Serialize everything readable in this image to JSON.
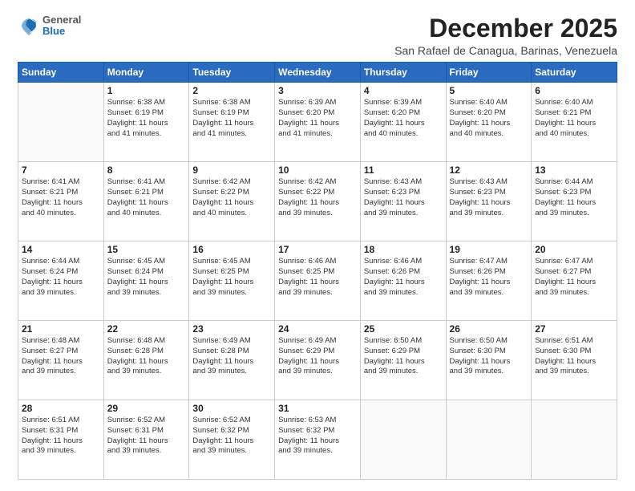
{
  "logo": {
    "general": "General",
    "blue": "Blue"
  },
  "title": "December 2025",
  "location": "San Rafael de Canagua, Barinas, Venezuela",
  "weekdays": [
    "Sunday",
    "Monday",
    "Tuesday",
    "Wednesday",
    "Thursday",
    "Friday",
    "Saturday"
  ],
  "weeks": [
    [
      {
        "day": "",
        "info": ""
      },
      {
        "day": "1",
        "info": "Sunrise: 6:38 AM\nSunset: 6:19 PM\nDaylight: 11 hours\nand 41 minutes."
      },
      {
        "day": "2",
        "info": "Sunrise: 6:38 AM\nSunset: 6:19 PM\nDaylight: 11 hours\nand 41 minutes."
      },
      {
        "day": "3",
        "info": "Sunrise: 6:39 AM\nSunset: 6:20 PM\nDaylight: 11 hours\nand 41 minutes."
      },
      {
        "day": "4",
        "info": "Sunrise: 6:39 AM\nSunset: 6:20 PM\nDaylight: 11 hours\nand 40 minutes."
      },
      {
        "day": "5",
        "info": "Sunrise: 6:40 AM\nSunset: 6:20 PM\nDaylight: 11 hours\nand 40 minutes."
      },
      {
        "day": "6",
        "info": "Sunrise: 6:40 AM\nSunset: 6:21 PM\nDaylight: 11 hours\nand 40 minutes."
      }
    ],
    [
      {
        "day": "7",
        "info": "Sunrise: 6:41 AM\nSunset: 6:21 PM\nDaylight: 11 hours\nand 40 minutes."
      },
      {
        "day": "8",
        "info": "Sunrise: 6:41 AM\nSunset: 6:21 PM\nDaylight: 11 hours\nand 40 minutes."
      },
      {
        "day": "9",
        "info": "Sunrise: 6:42 AM\nSunset: 6:22 PM\nDaylight: 11 hours\nand 40 minutes."
      },
      {
        "day": "10",
        "info": "Sunrise: 6:42 AM\nSunset: 6:22 PM\nDaylight: 11 hours\nand 39 minutes."
      },
      {
        "day": "11",
        "info": "Sunrise: 6:43 AM\nSunset: 6:23 PM\nDaylight: 11 hours\nand 39 minutes."
      },
      {
        "day": "12",
        "info": "Sunrise: 6:43 AM\nSunset: 6:23 PM\nDaylight: 11 hours\nand 39 minutes."
      },
      {
        "day": "13",
        "info": "Sunrise: 6:44 AM\nSunset: 6:23 PM\nDaylight: 11 hours\nand 39 minutes."
      }
    ],
    [
      {
        "day": "14",
        "info": "Sunrise: 6:44 AM\nSunset: 6:24 PM\nDaylight: 11 hours\nand 39 minutes."
      },
      {
        "day": "15",
        "info": "Sunrise: 6:45 AM\nSunset: 6:24 PM\nDaylight: 11 hours\nand 39 minutes."
      },
      {
        "day": "16",
        "info": "Sunrise: 6:45 AM\nSunset: 6:25 PM\nDaylight: 11 hours\nand 39 minutes."
      },
      {
        "day": "17",
        "info": "Sunrise: 6:46 AM\nSunset: 6:25 PM\nDaylight: 11 hours\nand 39 minutes."
      },
      {
        "day": "18",
        "info": "Sunrise: 6:46 AM\nSunset: 6:26 PM\nDaylight: 11 hours\nand 39 minutes."
      },
      {
        "day": "19",
        "info": "Sunrise: 6:47 AM\nSunset: 6:26 PM\nDaylight: 11 hours\nand 39 minutes."
      },
      {
        "day": "20",
        "info": "Sunrise: 6:47 AM\nSunset: 6:27 PM\nDaylight: 11 hours\nand 39 minutes."
      }
    ],
    [
      {
        "day": "21",
        "info": "Sunrise: 6:48 AM\nSunset: 6:27 PM\nDaylight: 11 hours\nand 39 minutes."
      },
      {
        "day": "22",
        "info": "Sunrise: 6:48 AM\nSunset: 6:28 PM\nDaylight: 11 hours\nand 39 minutes."
      },
      {
        "day": "23",
        "info": "Sunrise: 6:49 AM\nSunset: 6:28 PM\nDaylight: 11 hours\nand 39 minutes."
      },
      {
        "day": "24",
        "info": "Sunrise: 6:49 AM\nSunset: 6:29 PM\nDaylight: 11 hours\nand 39 minutes."
      },
      {
        "day": "25",
        "info": "Sunrise: 6:50 AM\nSunset: 6:29 PM\nDaylight: 11 hours\nand 39 minutes."
      },
      {
        "day": "26",
        "info": "Sunrise: 6:50 AM\nSunset: 6:30 PM\nDaylight: 11 hours\nand 39 minutes."
      },
      {
        "day": "27",
        "info": "Sunrise: 6:51 AM\nSunset: 6:30 PM\nDaylight: 11 hours\nand 39 minutes."
      }
    ],
    [
      {
        "day": "28",
        "info": "Sunrise: 6:51 AM\nSunset: 6:31 PM\nDaylight: 11 hours\nand 39 minutes."
      },
      {
        "day": "29",
        "info": "Sunrise: 6:52 AM\nSunset: 6:31 PM\nDaylight: 11 hours\nand 39 minutes."
      },
      {
        "day": "30",
        "info": "Sunrise: 6:52 AM\nSunset: 6:32 PM\nDaylight: 11 hours\nand 39 minutes."
      },
      {
        "day": "31",
        "info": "Sunrise: 6:53 AM\nSunset: 6:32 PM\nDaylight: 11 hours\nand 39 minutes."
      },
      {
        "day": "",
        "info": ""
      },
      {
        "day": "",
        "info": ""
      },
      {
        "day": "",
        "info": ""
      }
    ]
  ]
}
